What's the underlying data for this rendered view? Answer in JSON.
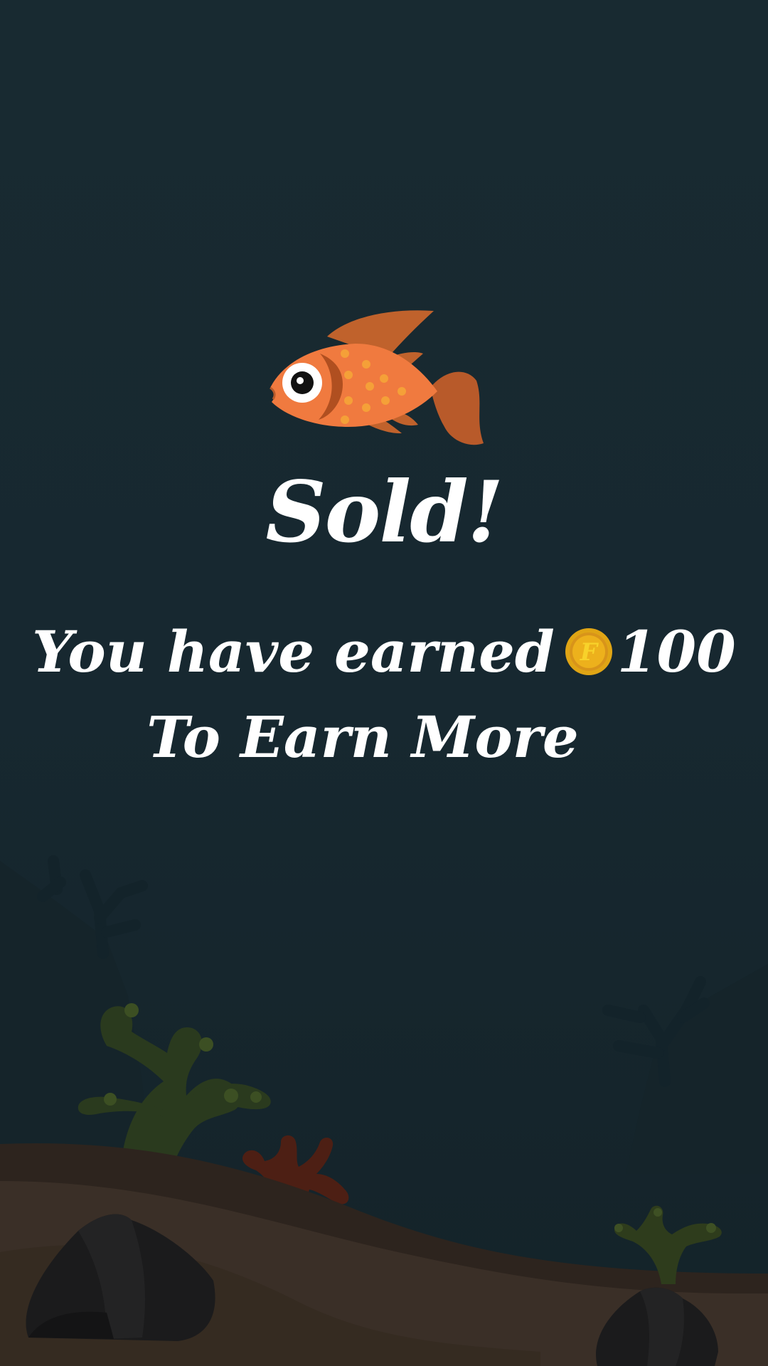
{
  "screen": {
    "title": "Sold!",
    "earned_prefix": "You have earned",
    "earned_amount": "100",
    "cta_text": "To Earn More"
  },
  "icons": {
    "fish": "fish-icon",
    "coin": "coin-icon",
    "coin_letter": "F"
  },
  "colors": {
    "background": "#17272e",
    "text": "#ffffff",
    "fish_body": "#f07a3f",
    "fish_fin": "#b85a2a",
    "fish_spots": "#f5a038",
    "coin_outer": "#e9b318",
    "coin_inner": "#f2c21c",
    "sand": "#3a2f27"
  }
}
